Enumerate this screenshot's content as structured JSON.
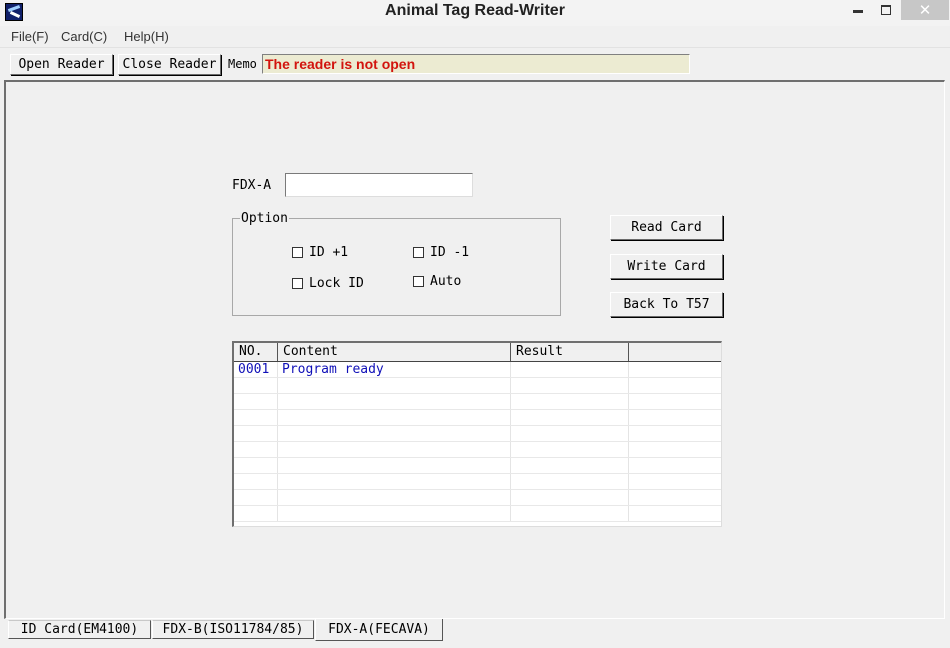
{
  "window": {
    "title": "Animal Tag Read-Writer",
    "icons": [
      "app-icon",
      "minimize-icon",
      "maximize-icon",
      "close-icon"
    ]
  },
  "menu": {
    "file": "File(F)",
    "card": "Card(C)",
    "help": "Help(H)"
  },
  "toolbar": {
    "open_reader": "Open Reader",
    "close_reader": "Close Reader",
    "memo_label": "Memo",
    "memo_text": "The reader is not open",
    "memo_color": "#d2140e",
    "memo_bg": "#ecebd2"
  },
  "form": {
    "fdxa_label": "FDX-A",
    "fdxa_value": "",
    "option_legend": "Option",
    "options": [
      {
        "label": "ID +1",
        "checked": false
      },
      {
        "label": "ID -1",
        "checked": false
      },
      {
        "label": "Lock ID",
        "checked": false
      },
      {
        "label": "Auto",
        "checked": false
      }
    ]
  },
  "actions": {
    "read_card": "Read Card",
    "write_card": "Write Card",
    "back_to_t57": "Back To T57"
  },
  "log": {
    "columns": [
      "NO.",
      "Content",
      "Result",
      ""
    ],
    "rows": [
      {
        "no": "0001",
        "content": "Program ready",
        "result": ""
      }
    ],
    "text_color": "#1010b8"
  },
  "tabs": [
    {
      "label": "ID Card(EM4100)",
      "active": false
    },
    {
      "label": "FDX-B(ISO11784/85)",
      "active": false
    },
    {
      "label": "FDX-A(FECAVA)",
      "active": true
    }
  ]
}
